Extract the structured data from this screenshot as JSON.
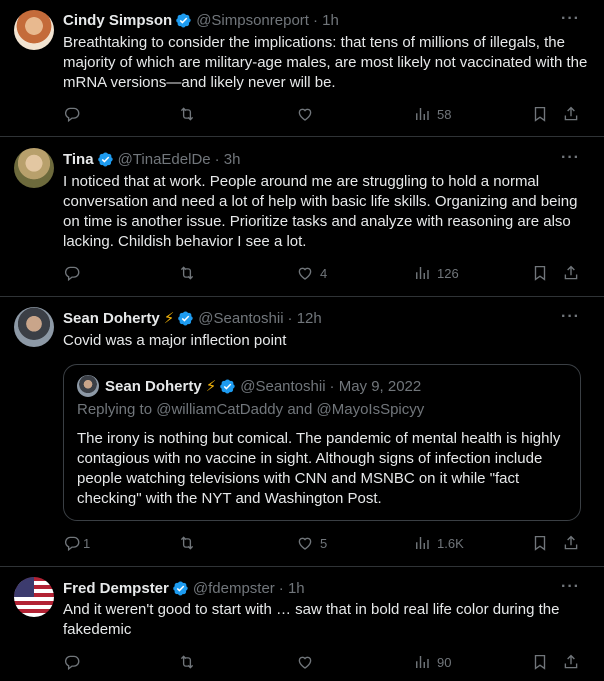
{
  "tweets": [
    {
      "name": "Cindy Simpson",
      "handle": "@Simpsonreport",
      "time": "· 1h",
      "text": "Breathtaking to consider the implications: that tens of millions of illegals, the majority of which are military-age males, are most likely not vaccinated with the mRNA versions—and likely never will be.",
      "views": "58",
      "likes": "",
      "replies": ""
    },
    {
      "name": "Tina",
      "handle": "@TinaEdelDe",
      "time": "· 3h",
      "text": "I noticed that at work. People around me are struggling to hold a normal conversation and need a lot of help with basic life skills. Organizing and being on time is another issue. Prioritize tasks and analyze with reasoning are also lacking. Childish behavior I see a lot.",
      "likes": "4",
      "views": "126",
      "replies": ""
    },
    {
      "name": "Sean Doherty",
      "emoji": "⚡",
      "handle": "@Seantoshii",
      "time": "· 12h",
      "text": "Covid was a major inflection point",
      "quote": {
        "name": "Sean Doherty",
        "emoji": "⚡",
        "handle": "@Seantoshii",
        "time": "· May 9, 2022",
        "reply_prefix": "Replying to",
        "reply_to": "@williamCatDaddy and @MayoIsSpicyy",
        "text": "The irony is nothing but comical.  The pandemic of mental health is highly contagious with no vaccine in sight.  Although signs of infection include people watching televisions with CNN and MSNBC on it while \"fact checking\" with the NYT and Washington Post."
      },
      "replies": "1",
      "likes": "5",
      "views": "1.6K"
    },
    {
      "name": "Fred Dempster",
      "handle": "@fdempster",
      "time": "· 1h",
      "text": "And it weren't good to start with … saw that in bold real life color during the fakedemic",
      "views": "90",
      "likes": "",
      "replies": ""
    }
  ],
  "more_label": "···",
  "colors": {
    "background": "#000000",
    "text": "#e7e9ea",
    "muted": "#71767b",
    "verified": "#1d9bf0",
    "divider": "#2f3336"
  },
  "icons": [
    "verified-badge-icon",
    "reply-icon",
    "retweet-icon",
    "like-icon",
    "views-icon",
    "bookmark-icon",
    "share-icon",
    "more-icon"
  ]
}
